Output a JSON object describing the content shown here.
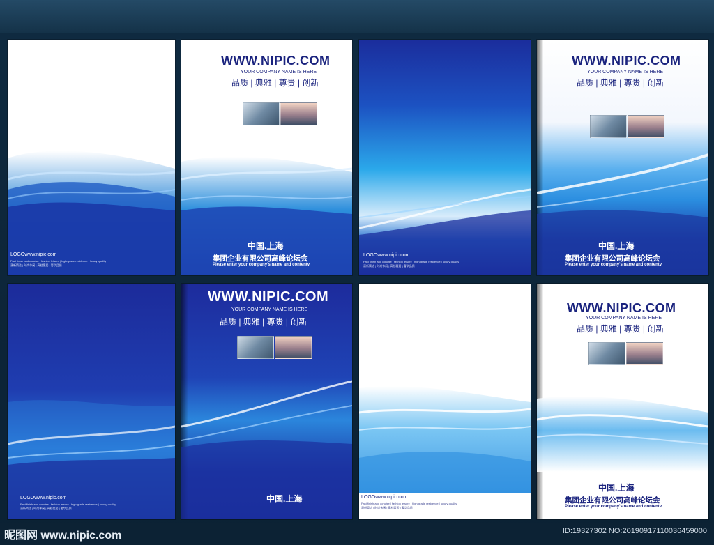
{
  "brochure": {
    "url": "WWW.NIPIC.COM",
    "tagline": "YOUR COMPANY NAME IS HERE",
    "slogan": "品质 | 典雅 | 尊贵 | 创新",
    "city": "中国.上海",
    "company": "集团企业有限公司高峰论坛会",
    "english": "Please enter your company's name and contentv",
    "logo": "LOGOwww.nipic.com",
    "logo_small_en": "Fast finish and concise | fashion leisure | high-grade residence | luxury quality",
    "logo_small_cn": "潇新简洁 | 时尚休闲 | 高档奢居 | 奢华品质"
  },
  "watermark": {
    "site": "昵图网 www.nipic.com",
    "id": "ID:19327302 NO:20190917110036459000"
  },
  "colors": {
    "deep_blue": "#1b2f9e",
    "bright_blue": "#1e88d8",
    "navy_text": "#1a237e",
    "white": "#ffffff"
  }
}
